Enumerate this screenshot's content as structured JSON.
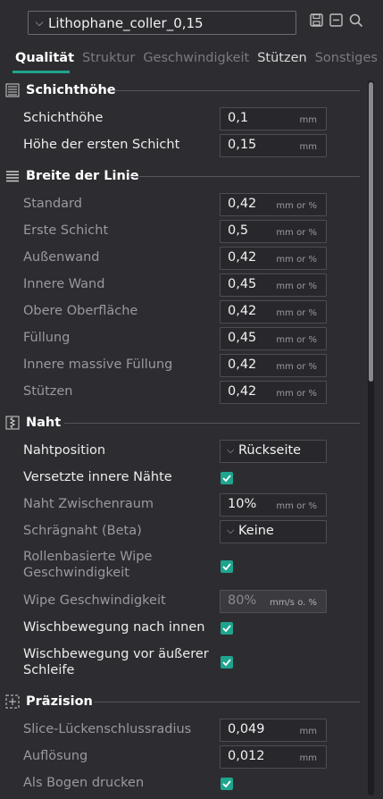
{
  "preset": {
    "name": "Lithophane_coller_0,15"
  },
  "tabs": [
    {
      "label": "Qualität"
    },
    {
      "label": "Struktur"
    },
    {
      "label": "Geschwindigkeit"
    },
    {
      "label": "Stützen"
    },
    {
      "label": "Sonstiges"
    }
  ],
  "sections": {
    "layer_height": {
      "title": "Schichthöhe",
      "rows": [
        {
          "label": "Schichthöhe",
          "value": "0,1",
          "unit": "mm"
        },
        {
          "label": "Höhe der ersten Schicht",
          "value": "0,15",
          "unit": "mm"
        }
      ]
    },
    "line_width": {
      "title": "Breite der Linie",
      "rows": [
        {
          "label": "Standard",
          "value": "0,42",
          "unit": "mm or %"
        },
        {
          "label": "Erste Schicht",
          "value": "0,5",
          "unit": "mm or %"
        },
        {
          "label": "Außenwand",
          "value": "0,42",
          "unit": "mm or %"
        },
        {
          "label": "Innere Wand",
          "value": "0,45",
          "unit": "mm or %"
        },
        {
          "label": "Obere Oberfläche",
          "value": "0,42",
          "unit": "mm or %"
        },
        {
          "label": "Füllung",
          "value": "0,45",
          "unit": "mm or %"
        },
        {
          "label": "Innere massive Füllung",
          "value": "0,42",
          "unit": "mm or %"
        },
        {
          "label": "Stützen",
          "value": "0,42",
          "unit": "mm or %"
        }
      ]
    },
    "seam": {
      "title": "Naht",
      "seam_position": {
        "label": "Nahtposition",
        "value": "Rückseite"
      },
      "staggered": {
        "label": "Versetzte innere Nähte",
        "checked": true
      },
      "seam_gap": {
        "label": "Naht Zwischenraum",
        "value": "10%",
        "unit": "mm or %"
      },
      "scarf": {
        "label": "Schrägnaht (Beta)",
        "value": "Keine"
      },
      "roll_wipe": {
        "label1": "Rollenbasierte Wipe",
        "label2": "Geschwindigkeit",
        "checked": true
      },
      "wipe_speed": {
        "label": "Wipe Geschwindigkeit",
        "value": "80%",
        "unit": "mm/s o. %"
      },
      "wipe_inward": {
        "label": "Wischbewegung nach innen",
        "checked": true
      },
      "wipe_before": {
        "label1": "Wischbewegung vor äußerer",
        "label2": "Schleife",
        "checked": true
      }
    },
    "precision": {
      "title": "Präzision",
      "gap_closing": {
        "label": "Slice-Lückenschlussradius",
        "value": "0,049",
        "unit": "mm"
      },
      "resolution": {
        "label": "Auflösung",
        "value": "0,012",
        "unit": "mm"
      },
      "arc": {
        "label": "Als Bogen drucken",
        "checked": true
      }
    }
  },
  "colors": {
    "accent": "#1fa48e",
    "background": "#2d2d31"
  }
}
